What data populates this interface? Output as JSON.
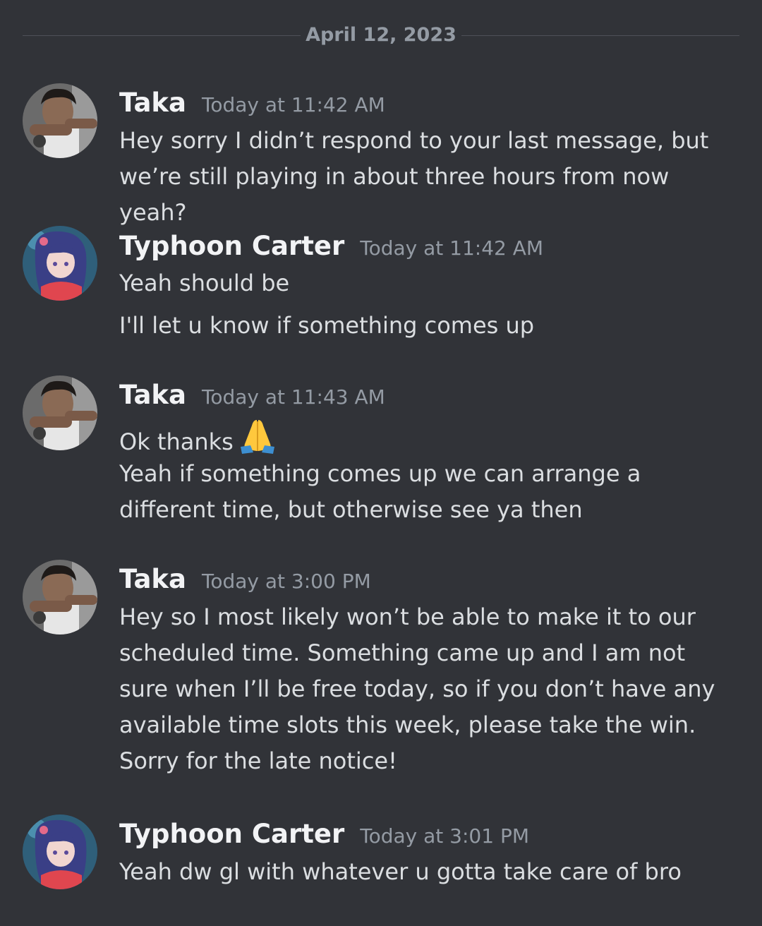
{
  "date_divider": "April 12, 2023",
  "messages": [
    {
      "author": "Taka",
      "timestamp": "Today at 11:42 AM",
      "lines": [
        "Hey sorry I didn’t respond to your last message, but we’re still playing in about three hours from now yeah?"
      ]
    },
    {
      "author": "Typhoon Carter",
      "timestamp": "Today at 11:42 AM",
      "lines": [
        "Yeah should be",
        "I'll let u know if something comes up"
      ]
    },
    {
      "author": "Taka",
      "timestamp": "Today at 11:43 AM",
      "lines": [
        "Ok thanks",
        "Yeah if something comes up we can arrange a different time, but otherwise see ya then"
      ],
      "emoji": "folded-hands-emoji"
    },
    {
      "author": "Taka",
      "timestamp": "Today at 3:00 PM",
      "lines": [
        "Hey so I most likely won’t be able to make it to our scheduled time. Something came up and I am not sure when I’ll be free today, so if you don’t have any available time slots this week, please take the win. Sorry for the late notice!"
      ]
    },
    {
      "author": "Typhoon Carter",
      "timestamp": "Today at 3:01 PM",
      "lines": [
        "Yeah dw gl with whatever u gotta take care of bro"
      ]
    }
  ],
  "colors": {
    "background": "#313338",
    "username": "#f2f3f5",
    "timestamp": "#949ba4",
    "message_text": "#dbdee1",
    "divider": "#4e5058"
  }
}
